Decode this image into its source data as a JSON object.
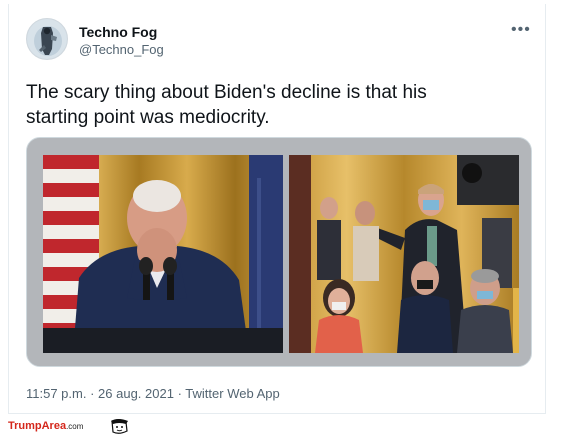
{
  "author": {
    "display_name": "Techno Fog",
    "handle": "@Techno_Fog",
    "avatar_icon": "avatar-photo"
  },
  "menu": {
    "more_label": "•••"
  },
  "tweet": {
    "text_line1": "The scary thing about Biden's decline is that his",
    "text_line2": "starting point was mediocrity."
  },
  "timestamp": {
    "time": "11:57 p.m.",
    "separator": "·",
    "date": "26 aug. 2021",
    "source": "Twitter Web App"
  },
  "watermark": {
    "brand": "TrumpArea",
    "domain": ".com"
  },
  "colors": {
    "text_primary": "#0f1419",
    "text_secondary": "#536471",
    "watermark_red": "#d4271b"
  }
}
